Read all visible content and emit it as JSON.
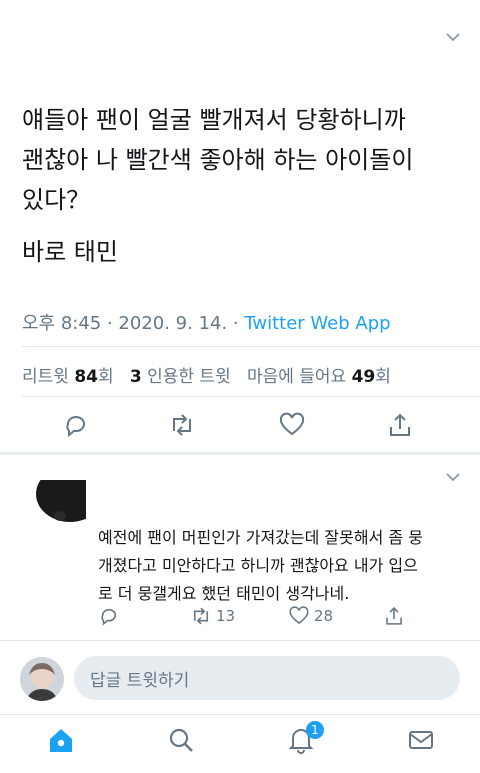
{
  "tweet": {
    "lines": [
      "얘들아 팬이 얼굴 빨개져서 당황하니까",
      "괜찮아 나 빨간색 좋아해 하는 아이돌이",
      "있다？"
    ],
    "line2": "바로 태민",
    "time": "오후 8:45 · 2020. 9. 14. · ",
    "source": "Twitter Web App"
  },
  "stats": {
    "retweets_label": "리트윗",
    "retweets_count": "84",
    "retweets_unit": "회",
    "quotes_count": "3",
    "quotes_label": "인용한 트윗",
    "likes_label": "마음에 들어요",
    "likes_count": "49",
    "likes_unit": "회"
  },
  "reply": {
    "lines": [
      "예전에 팬이 머핀인가 가져갔는데 잘못해서 좀 뭉",
      "개졌다고 미안하다고 하니까 괜찮아요 내가 입으",
      "로 더 뭉갤게요 했던 태민이 생각나네."
    ],
    "retweet_count": "13",
    "like_count": "28"
  },
  "compose": {
    "placeholder": "답글 트윗하기"
  },
  "tabbar": {
    "notifications_badge": "1"
  },
  "colors": {
    "accent": "#1da1f2",
    "secondary_text": "#657786",
    "divider": "#e1e8ed"
  }
}
